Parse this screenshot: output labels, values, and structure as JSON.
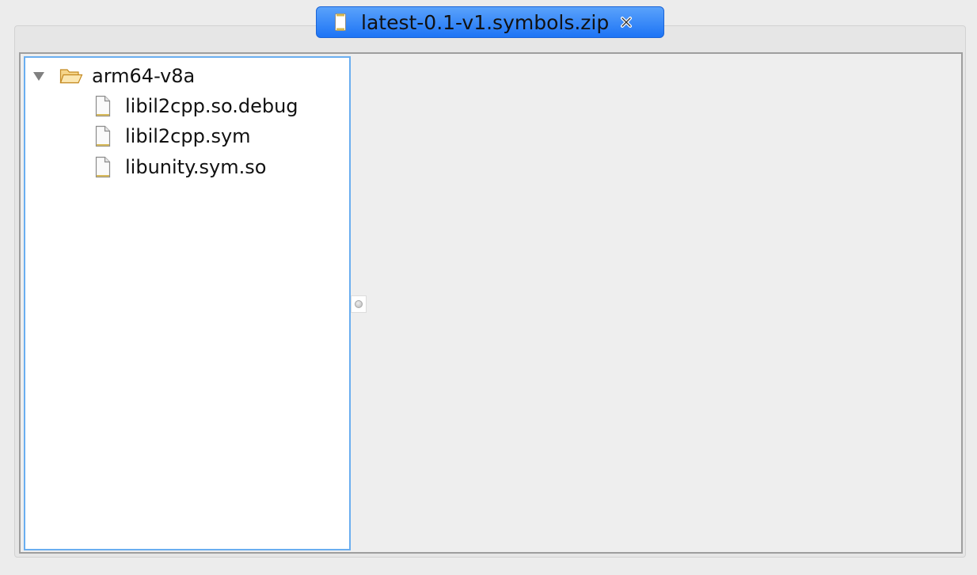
{
  "tab": {
    "title": "latest-0.1-v1.symbols.zip",
    "icon": "archive-icon",
    "close_icon": "close-icon",
    "active_color": "#2f80f6"
  },
  "tree": {
    "root": {
      "label": "arm64-v8a",
      "icon": "folder-open-icon",
      "expanded": true,
      "children": [
        {
          "label": "libil2cpp.so.debug",
          "icon": "file-icon"
        },
        {
          "label": "libil2cpp.sym",
          "icon": "file-icon"
        },
        {
          "label": "libunity.sym.so",
          "icon": "file-icon"
        }
      ]
    },
    "focus_border_color": "#6aaef0"
  }
}
